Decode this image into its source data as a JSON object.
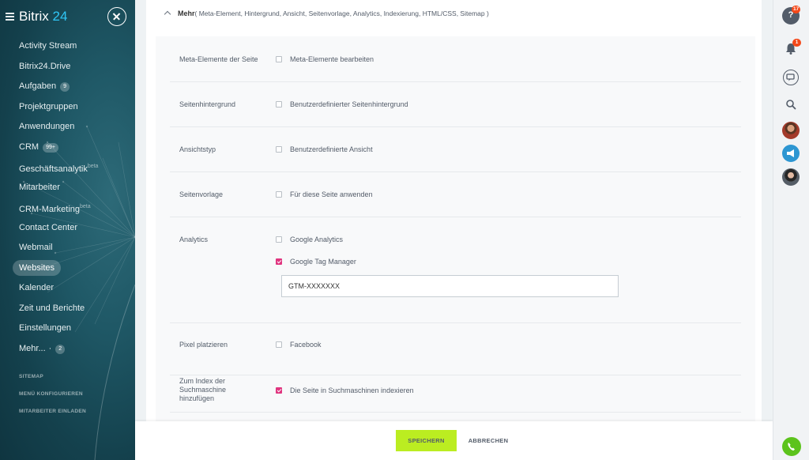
{
  "brand": {
    "name": "Bitrix",
    "number": "24"
  },
  "sidebar": {
    "items": [
      {
        "label": "Activity Stream"
      },
      {
        "label": "Bitrix24.Drive"
      },
      {
        "label": "Aufgaben",
        "counter": "9"
      },
      {
        "label": "Projektgruppen"
      },
      {
        "label": "Anwendungen"
      },
      {
        "label": "CRM",
        "counter": "99+"
      },
      {
        "label": "Geschäftsanalytik",
        "tag": "beta"
      },
      {
        "label": "Mitarbeiter"
      },
      {
        "label": "CRM-Marketing",
        "tag": "beta"
      },
      {
        "label": "Contact Center"
      },
      {
        "label": "Webmail"
      },
      {
        "label": "Websites",
        "active": true
      },
      {
        "label": "Kalender"
      },
      {
        "label": "Zeit und Berichte"
      },
      {
        "label": "Einstellungen"
      },
      {
        "label": "Mehr...",
        "dot": "·",
        "counter": "2"
      }
    ],
    "links": [
      "SITEMAP",
      "MENÜ KONFIGURIEREN",
      "MITARBEITER EINLADEN"
    ]
  },
  "section": {
    "title": "Mehr",
    "subtitle": "( Meta-Element,  Hintergrund,  Ansicht,  Seitenvorlage,  Analytics,  Indexierung,  HTML/CSS,  Sitemap )"
  },
  "rows": {
    "meta": {
      "label": "Meta-Elemente der Seite",
      "option": "Meta-Elemente bearbeiten",
      "checked": false
    },
    "background": {
      "label": "Seitenhintergrund",
      "option": "Benutzerdefinierter Seitenhintergrund",
      "checked": false
    },
    "view": {
      "label": "Ansichtstyp",
      "option": "Benutzerdefinierte Ansicht",
      "checked": false
    },
    "template": {
      "label": "Seitenvorlage",
      "option": "Für diese Seite anwenden",
      "checked": false
    },
    "analytics": {
      "label": "Analytics",
      "google_analytics": {
        "label": "Google Analytics",
        "checked": false
      },
      "google_tag_manager": {
        "label": "Google Tag Manager",
        "checked": true
      },
      "gtm_value": "GTM-XXXXXXX"
    },
    "pixel": {
      "label": "Pixel platzieren",
      "option": "Facebook",
      "checked": false
    },
    "index": {
      "label": "Zum Index der Suchmaschine hinzufügen",
      "option": "Die Seite in Suchmaschinen indexieren",
      "checked": true
    }
  },
  "footer": {
    "save_label": "SPEICHERN",
    "cancel_label": "ABBRECHEN"
  },
  "rightbar": {
    "help_badge": "17",
    "notifications_badge": "1",
    "help_glyph": "?"
  },
  "colors": {
    "accent_green": "#bbed21",
    "checkbox_checked": "#e0357f",
    "brand_blue": "#2fc6f6",
    "phone_green": "#5cc31c"
  }
}
